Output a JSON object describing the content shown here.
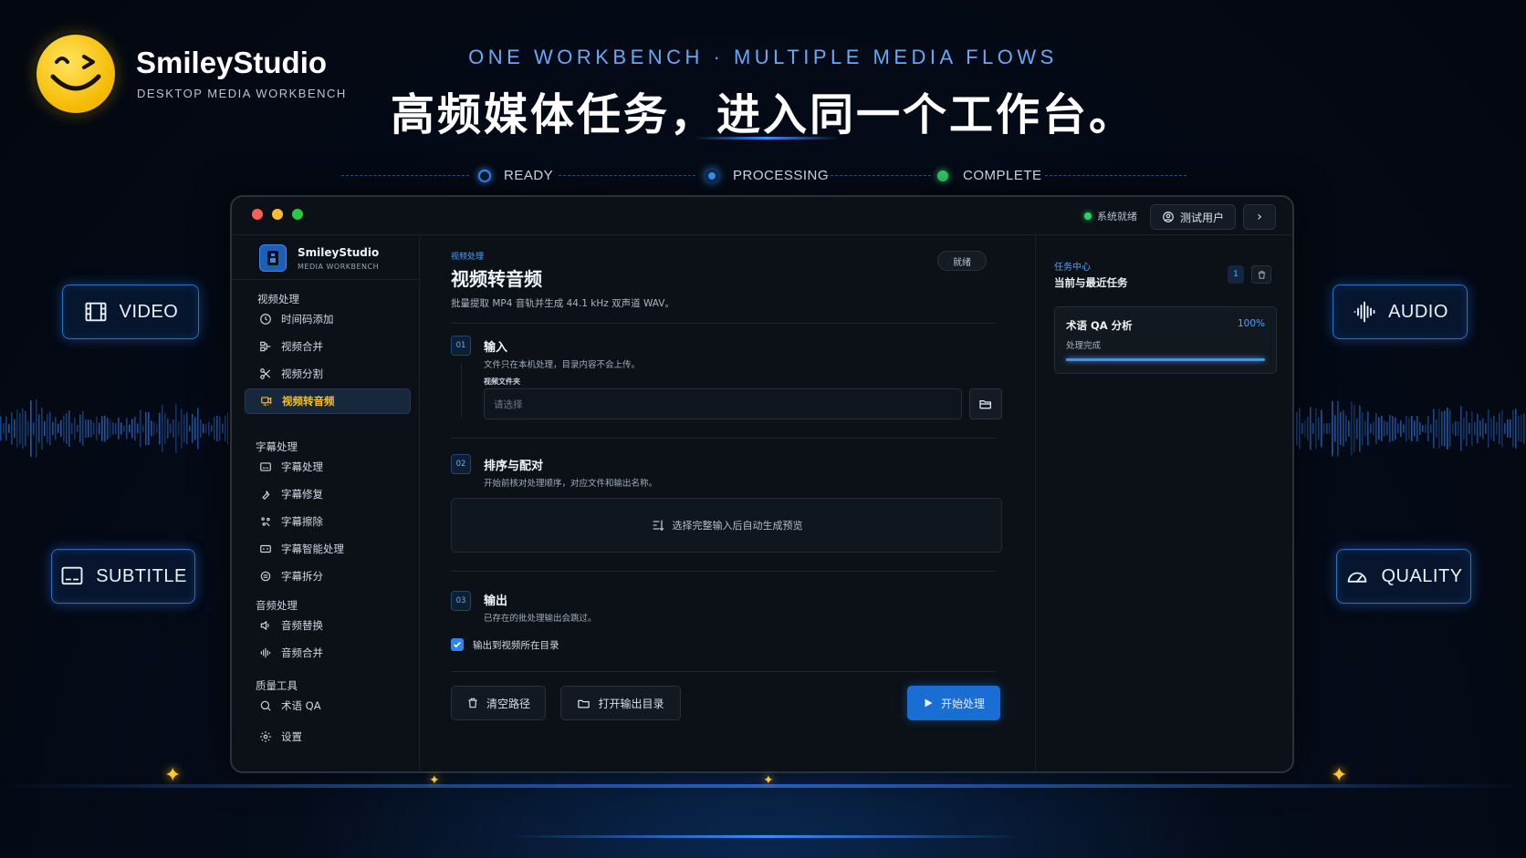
{
  "brand": {
    "name": "SmileyStudio",
    "subtitle": "DESKTOP MEDIA WORKBENCH"
  },
  "hero": {
    "tagline": "ONE WORKBENCH · MULTIPLE MEDIA FLOWS",
    "headline": "高频媒体任务，进入同一个工作台。"
  },
  "flow": {
    "ready": "READY",
    "processing": "PROCESSING",
    "complete": "COMPLETE"
  },
  "badges": {
    "video": "VIDEO",
    "subtitle": "SUBTITLE",
    "audio": "AUDIO",
    "quality": "QUALITY"
  },
  "colors": {
    "accent": "#2f86ea",
    "active": "#f2bf2d",
    "ready_green": "#2fcf6a"
  },
  "titlebar": {
    "status": "系统就绪",
    "user": "测试用户"
  },
  "sidebar": {
    "name": "SmileyStudio",
    "sub": "MEDIA WORKBENCH",
    "groups": [
      "视频处理",
      "字幕处理",
      "音频处理",
      "质量工具"
    ],
    "video": [
      "时间码添加",
      "视频合并",
      "视频分割",
      "视频转音频"
    ],
    "subtitle": [
      "字幕处理",
      "字幕修复",
      "字幕擦除",
      "字幕智能处理",
      "字幕拆分"
    ],
    "audio": [
      "音频替换",
      "音频合并"
    ],
    "quality": [
      "术语 QA",
      "设置"
    ]
  },
  "main": {
    "crumb": "视频处理",
    "title": "视频转音频",
    "desc": "批量提取 MP4 音轨并生成 44.1 kHz 双声道 WAV。",
    "state": "就绪",
    "steps": [
      {
        "num": "01",
        "title": "输入",
        "desc": "文件只在本机处理，目录内容不会上传。"
      },
      {
        "num": "02",
        "title": "排序与配对",
        "desc": "开始前核对处理顺序，对应文件和输出名称。"
      },
      {
        "num": "03",
        "title": "输出",
        "desc": "已存在的批处理输出会跳过。"
      }
    ],
    "field_label": "视频文件夹",
    "field_placeholder": "请选择",
    "preview_text": "选择完整输入后自动生成预览",
    "checkbox_label": "输出到视频所在目录",
    "btn_clear": "清空路径",
    "btn_open": "打开输出目录",
    "btn_start": "开始处理"
  },
  "tasks": {
    "kicker": "任务中心",
    "title": "当前与最近任务",
    "count": "1",
    "item": {
      "name": "术语 QA 分析",
      "percent": "100%",
      "state": "处理完成",
      "progress": 1.0
    }
  }
}
